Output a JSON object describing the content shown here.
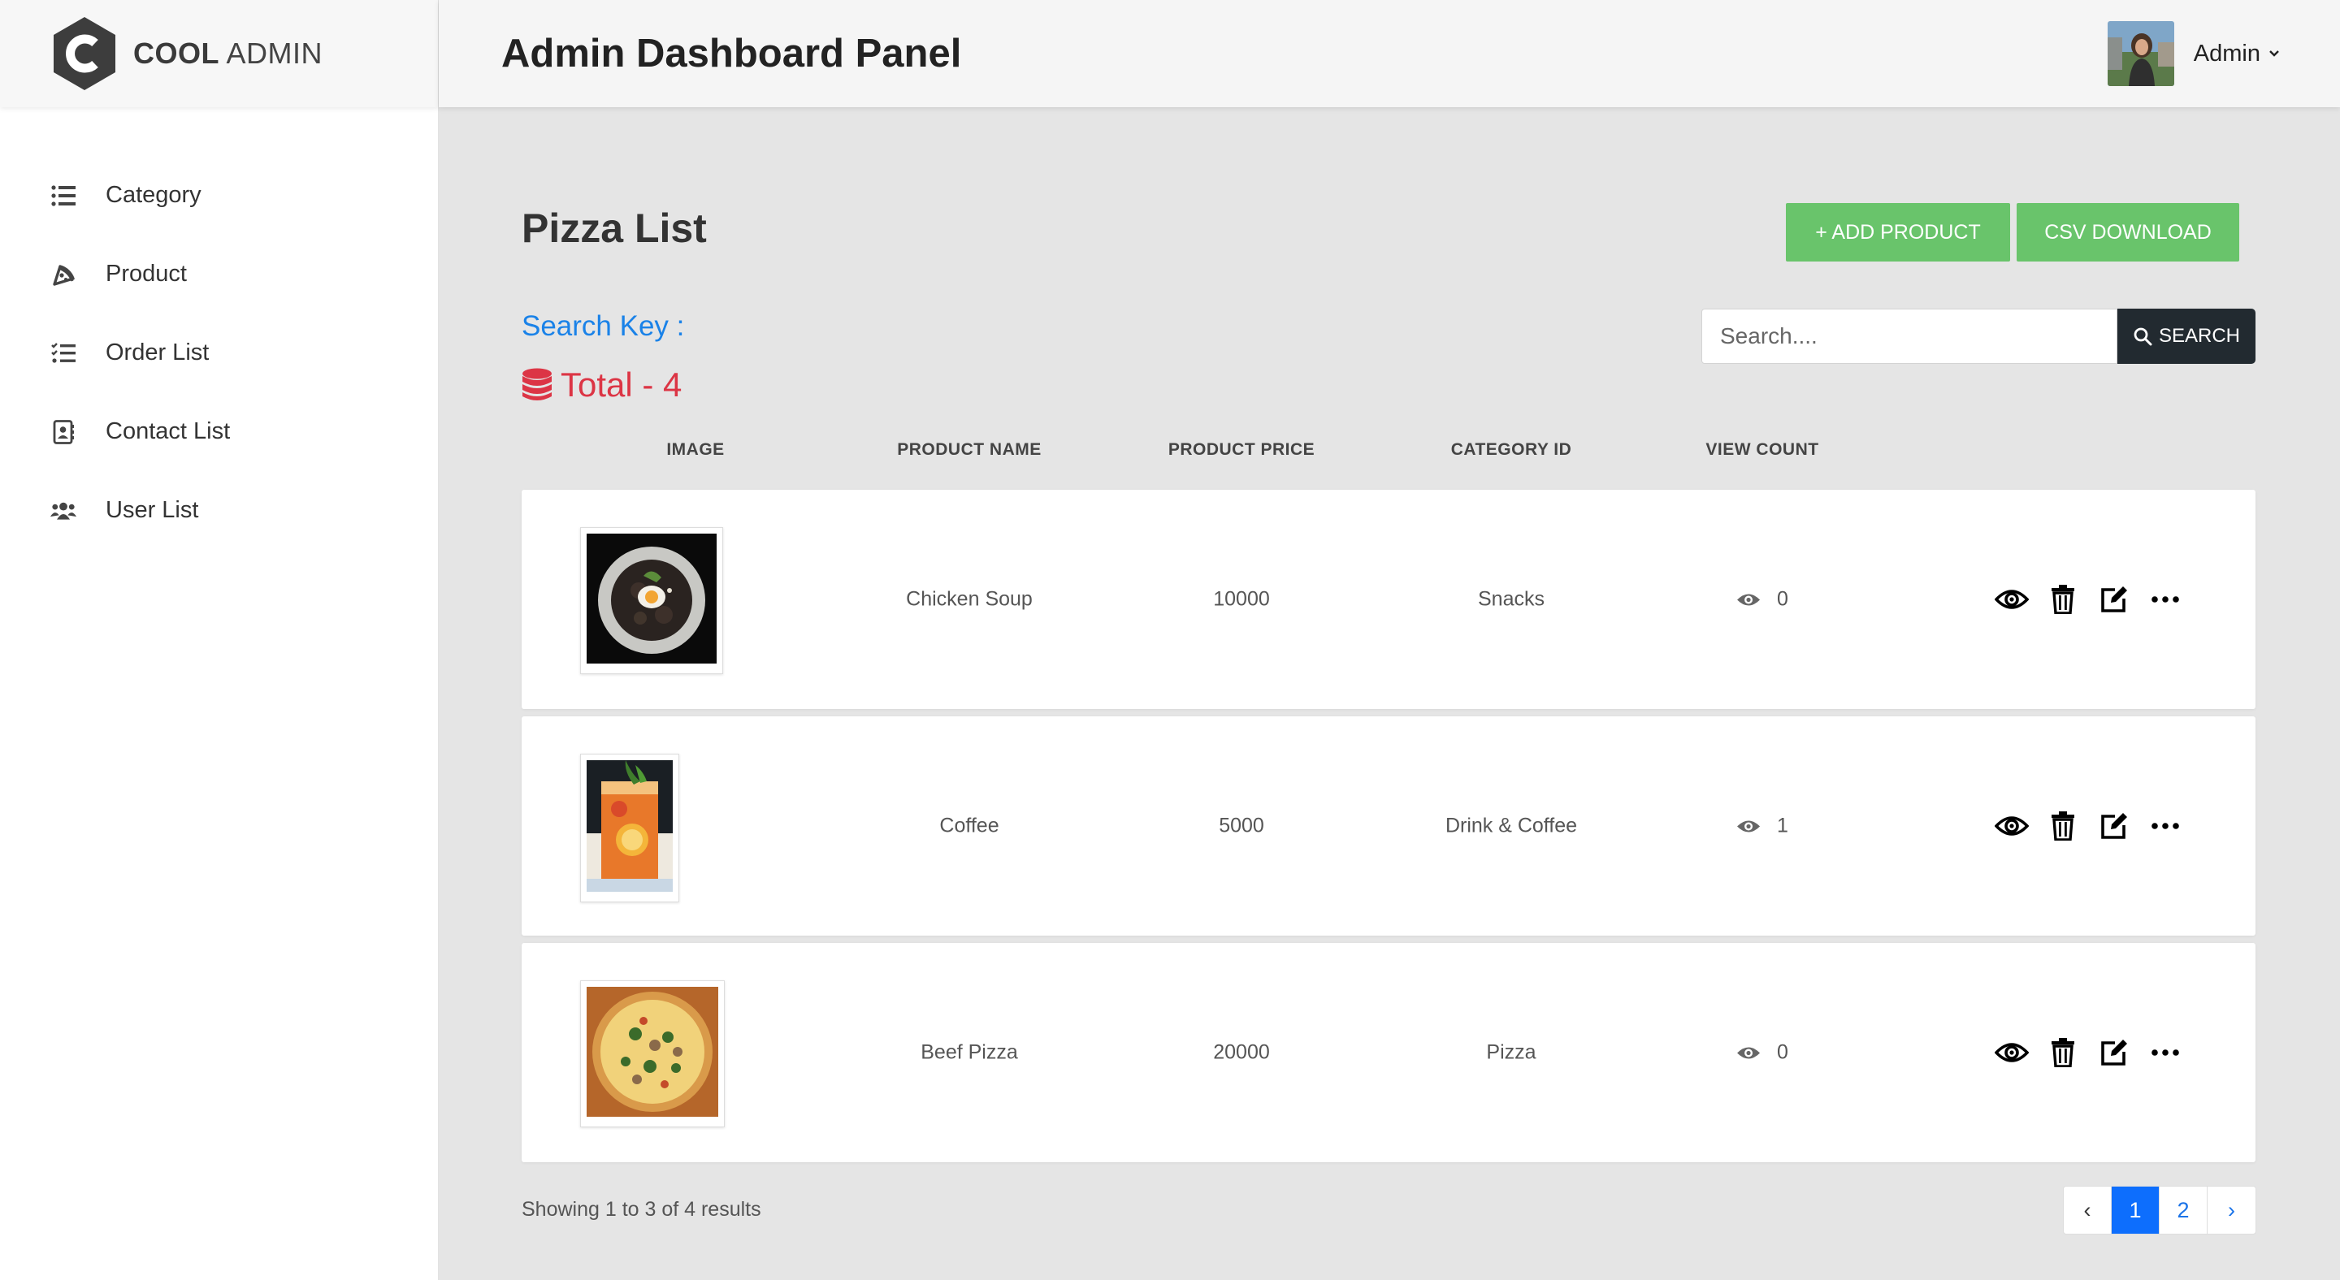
{
  "brand": {
    "bold": "COOL",
    "light": "ADMIN"
  },
  "header": {
    "title": "Admin Dashboard Panel",
    "user_name": "Admin"
  },
  "sidebar": {
    "items": [
      {
        "label": "Category",
        "icon": "list-icon"
      },
      {
        "label": "Product",
        "icon": "pizza-icon"
      },
      {
        "label": "Order List",
        "icon": "tasks-icon"
      },
      {
        "label": "Contact List",
        "icon": "address-book-icon"
      },
      {
        "label": "User List",
        "icon": "users-icon"
      }
    ]
  },
  "main": {
    "title": "Pizza List",
    "add_button": "+ ADD PRODUCT",
    "csv_button": "CSV DOWNLOAD",
    "search_key_label": "Search Key :",
    "total_label": "Total - 4",
    "search_placeholder": "Search....",
    "search_button": "SEARCH",
    "columns": [
      "IMAGE",
      "PRODUCT NAME",
      "PRODUCT PRICE",
      "CATEGORY ID",
      "VIEW COUNT"
    ],
    "rows": [
      {
        "name": "Chicken Soup",
        "price": "10000",
        "category": "Snacks",
        "views": "0",
        "image": "soup-photo"
      },
      {
        "name": "Coffee",
        "price": "5000",
        "category": "Drink & Coffee",
        "views": "1",
        "image": "drink-photo"
      },
      {
        "name": "Beef Pizza",
        "price": "20000",
        "category": "Pizza",
        "views": "0",
        "image": "pizza-photo"
      }
    ],
    "showing": "Showing 1 to 3 of 4 results",
    "pagination": {
      "prev": "‹",
      "pages": [
        "1",
        "2"
      ],
      "current": "1",
      "next": "›"
    }
  },
  "colors": {
    "green": "#69c46b",
    "danger": "#dc3545",
    "link": "#1a82e8",
    "primary": "#0d6efd",
    "search_btn": "#222a30"
  }
}
